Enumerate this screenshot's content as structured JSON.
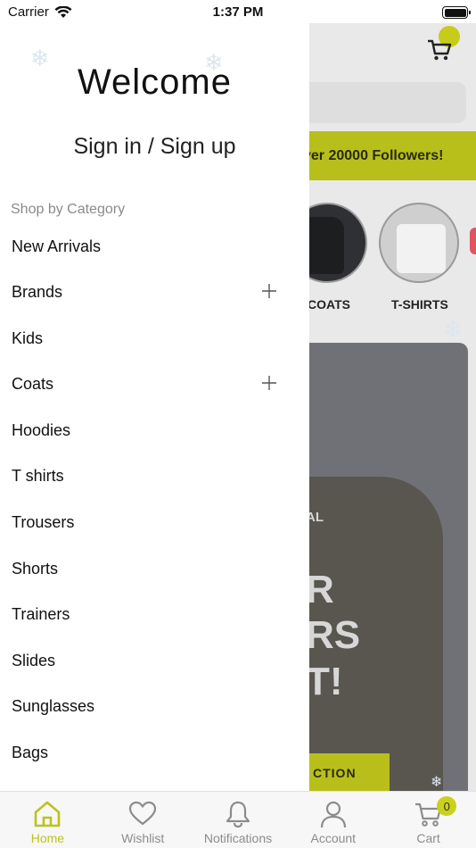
{
  "status_bar": {
    "carrier": "Carrier",
    "time": "1:37 PM"
  },
  "background_app": {
    "banner_text": "ver 20000 Followers!",
    "categories": [
      {
        "label": "COATS"
      },
      {
        "label": "T-SHIRTS"
      }
    ],
    "hero": {
      "line1": "AL",
      "line2": "R",
      "line3": "RS",
      "line4": "T!",
      "button": "CTION"
    }
  },
  "drawer": {
    "welcome": "Welcome",
    "sign_in": "Sign in / Sign up",
    "section_label": "Shop by Category",
    "items": [
      {
        "label": "New Arrivals",
        "expandable": false
      },
      {
        "label": "Brands",
        "expandable": true
      },
      {
        "label": "Kids",
        "expandable": false
      },
      {
        "label": "Coats",
        "expandable": true
      },
      {
        "label": "Hoodies",
        "expandable": false
      },
      {
        "label": "T shirts",
        "expandable": false
      },
      {
        "label": "Trousers",
        "expandable": false
      },
      {
        "label": "Shorts",
        "expandable": false
      },
      {
        "label": "Trainers",
        "expandable": false
      },
      {
        "label": "Slides",
        "expandable": false
      },
      {
        "label": "Sunglasses",
        "expandable": false
      },
      {
        "label": "Bags",
        "expandable": false
      }
    ]
  },
  "tab_bar": {
    "active_color": "#bdc21c",
    "tabs": [
      {
        "label": "Home",
        "icon": "home-icon",
        "active": true
      },
      {
        "label": "Wishlist",
        "icon": "heart-icon",
        "active": false
      },
      {
        "label": "Notifications",
        "icon": "bell-icon",
        "active": false
      },
      {
        "label": "Account",
        "icon": "user-icon",
        "active": false
      },
      {
        "label": "Cart",
        "icon": "cart-icon",
        "active": false
      }
    ],
    "cart_count": "0"
  }
}
